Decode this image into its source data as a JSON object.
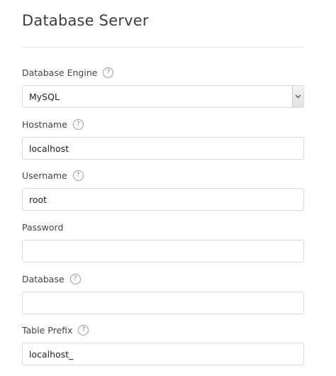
{
  "section": {
    "title": "Database Server"
  },
  "fields": {
    "engine": {
      "label": "Database Engine",
      "value": "MySQL",
      "has_help": true
    },
    "hostname": {
      "label": "Hostname",
      "value": "localhost",
      "has_help": true
    },
    "username": {
      "label": "Username",
      "value": "root",
      "has_help": true
    },
    "password": {
      "label": "Password",
      "value": "",
      "has_help": false
    },
    "database": {
      "label": "Database",
      "value": "",
      "has_help": true
    },
    "table_prefix": {
      "label": "Table Prefix",
      "value": "localhost_",
      "has_help": true
    }
  },
  "icons": {
    "help": "question-circle-icon",
    "dropdown": "chevron-down-icon"
  },
  "colors": {
    "border": "#d9d9d9",
    "text": "#333333",
    "divider": "#e3e3e3"
  }
}
